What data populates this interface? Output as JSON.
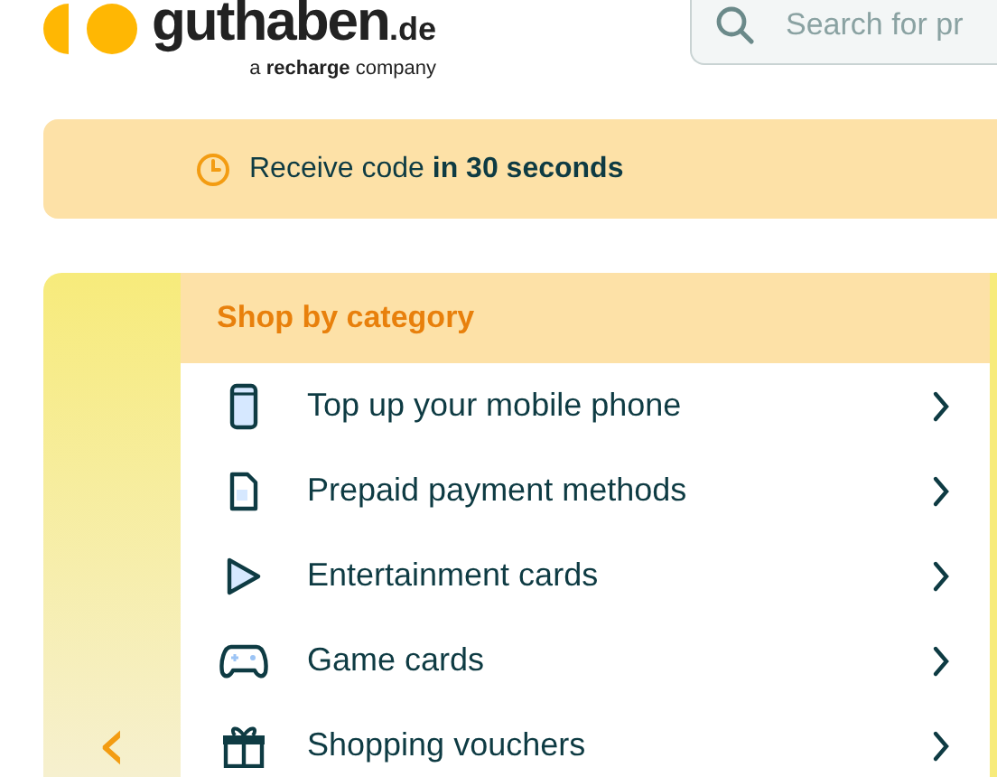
{
  "header": {
    "logo": {
      "name": "guthaben",
      "tld": ".de",
      "tagline": "a **recharge** company"
    },
    "search": {
      "placeholder": "Search for pr"
    }
  },
  "banner": {
    "text": "Receive code **in 30 seconds**"
  },
  "carousel": {
    "prev": "‹"
  },
  "menu": {
    "title": "Shop by category",
    "items": [
      {
        "kind": "phone",
        "label": "Top up your mobile phone"
      },
      {
        "kind": "card",
        "label": "Prepaid payment methods"
      },
      {
        "kind": "play",
        "label": "Entertainment cards"
      },
      {
        "kind": "gamepad",
        "label": "Game cards"
      },
      {
        "kind": "gift",
        "label": "Shopping vouchers"
      }
    ]
  }
}
